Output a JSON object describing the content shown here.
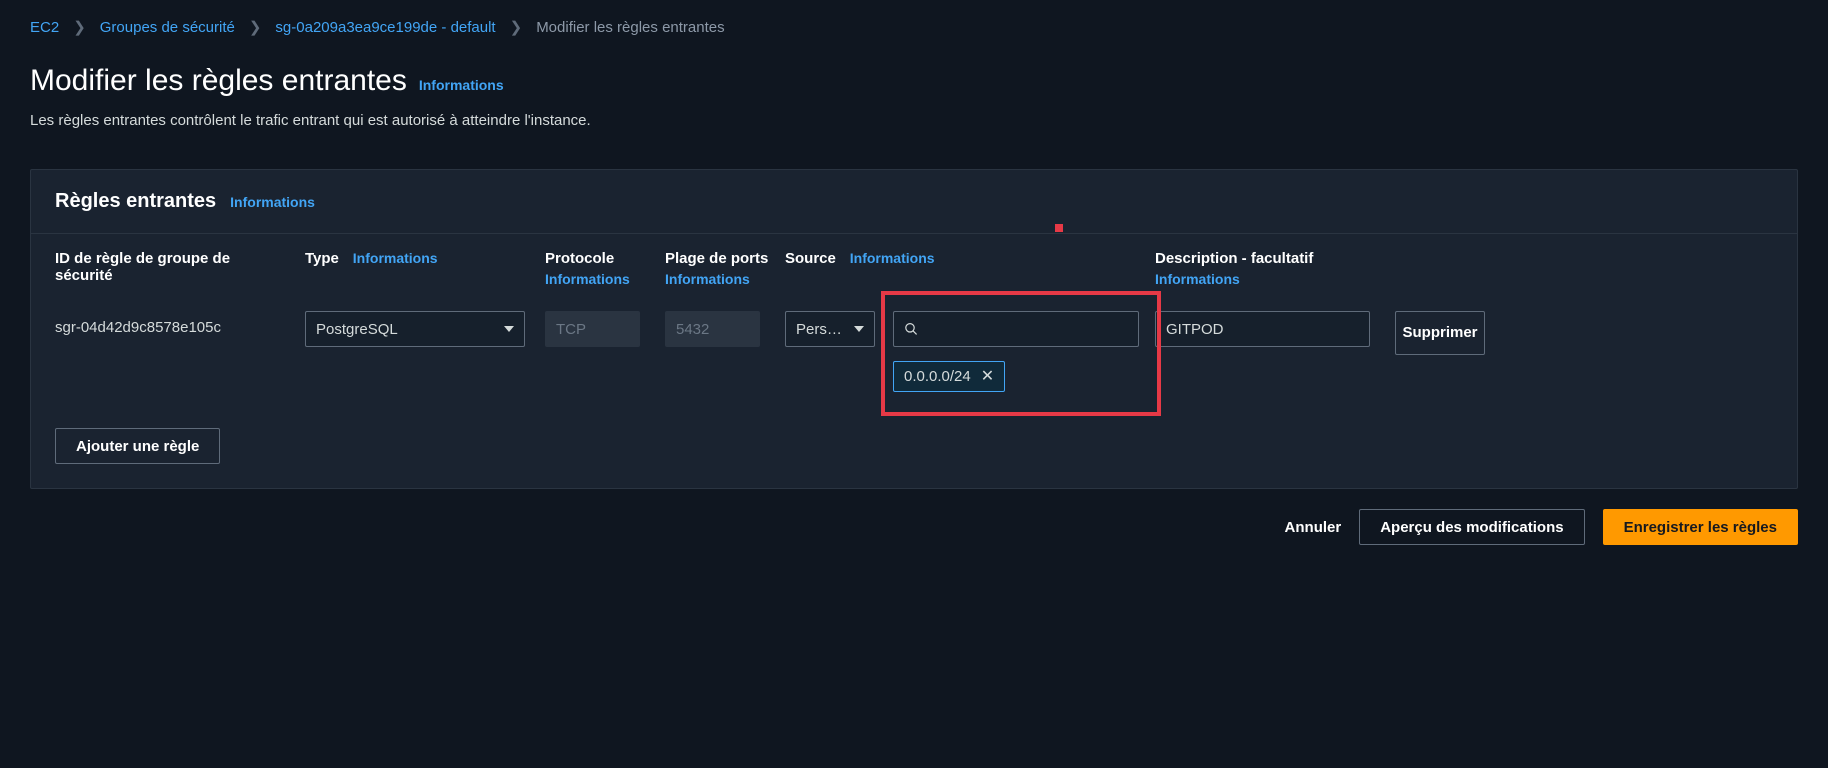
{
  "breadcrumb": {
    "items": [
      "EC2",
      "Groupes de sécurité",
      "sg-0a209a3ea9ce199de - default"
    ],
    "current": "Modifier les règles entrantes"
  },
  "header": {
    "title": "Modifier les règles entrantes",
    "info": "Informations",
    "description": "Les règles entrantes contrôlent le trafic entrant qui est autorisé à atteindre l'instance."
  },
  "panel": {
    "title": "Règles entrantes",
    "info": "Informations"
  },
  "columns": {
    "id": "ID de règle de groupe de sécurité",
    "type": "Type",
    "type_info": "Informations",
    "protocol": "Protocole",
    "protocol_info": "Informations",
    "ports": "Plage de ports",
    "ports_info": "Informations",
    "source": "Source",
    "source_info": "Informations",
    "desc": "Description - facultatif",
    "desc_info": "Informations"
  },
  "row": {
    "id": "sgr-04d42d9c8578e105c",
    "type": "PostgreSQL",
    "protocol": "TCP",
    "ports": "5432",
    "source_mode": "Pers…",
    "source_chip": "0.0.0.0/24",
    "description": "GITPOD",
    "delete": "Supprimer"
  },
  "actions": {
    "add_rule": "Ajouter une règle",
    "cancel": "Annuler",
    "preview": "Aperçu des modifications",
    "save": "Enregistrer les règles"
  }
}
